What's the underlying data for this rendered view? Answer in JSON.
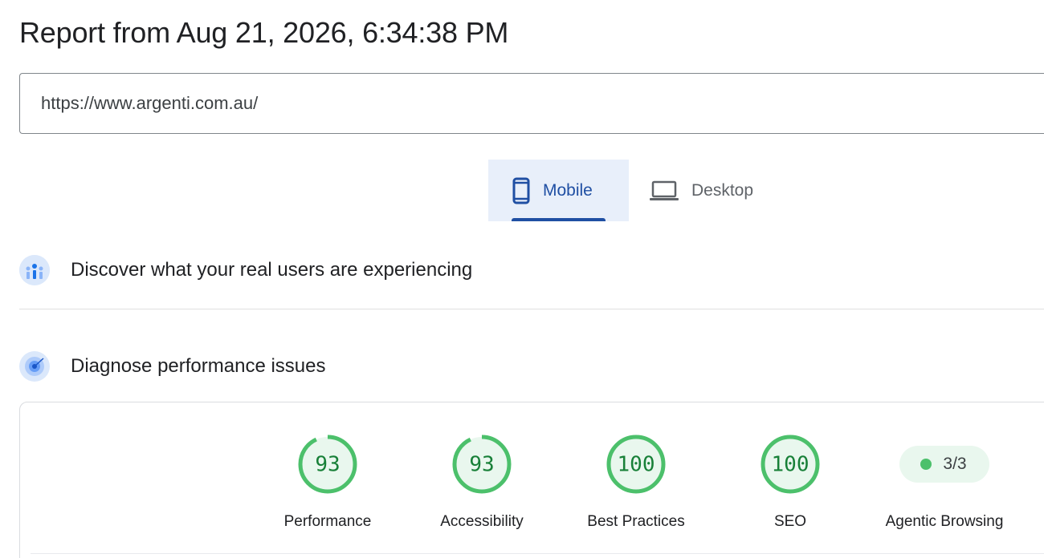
{
  "report": {
    "title": "Report from Aug 21, 2026, 6:34:38 PM",
    "url": "https://www.argenti.com.au/"
  },
  "tabs": [
    {
      "label": "Mobile",
      "icon": "phone-icon",
      "selected": true
    },
    {
      "label": "Desktop",
      "icon": "laptop-icon",
      "selected": false
    }
  ],
  "sections": {
    "real_users": {
      "label": "Discover what your real users are experiencing",
      "icon": "users-chart-icon"
    },
    "diagnose": {
      "label": "Diagnose performance issues",
      "icon": "radar-icon"
    }
  },
  "scores": [
    {
      "label": "Performance",
      "score": "93",
      "value": 93
    },
    {
      "label": "Accessibility",
      "score": "93",
      "value": 93
    },
    {
      "label": "Best Practices",
      "score": "100",
      "value": 100
    },
    {
      "label": "SEO",
      "score": "100",
      "value": 100
    }
  ],
  "agentic": {
    "label": "Agentic Browsing",
    "value": "3/3"
  },
  "colors": {
    "accent_blue": "#1f4fa3",
    "tab_bg": "#e8effa",
    "pass_green": "#4cc06b",
    "pass_text": "#188038",
    "pass_fill": "#e9f7ee"
  }
}
